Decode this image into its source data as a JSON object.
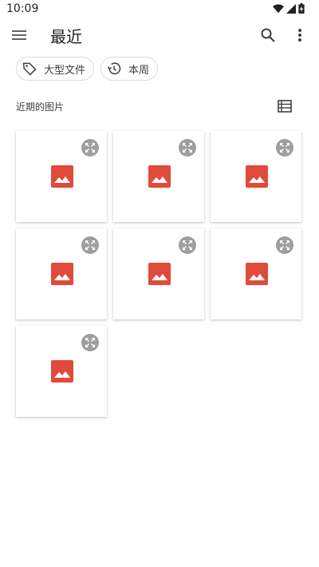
{
  "status_bar": {
    "time": "10:09"
  },
  "app_bar": {
    "title": "最近"
  },
  "chips": [
    {
      "label": "大型文件",
      "icon": "label-icon"
    },
    {
      "label": "本周",
      "icon": "history-icon"
    }
  ],
  "section": {
    "title": "近期的图片"
  },
  "colors": {
    "image_icon": "#e04a3b",
    "expand_icon": "#9e9e9e",
    "text": "#202124"
  },
  "images": [
    {
      "icon": "image-icon"
    },
    {
      "icon": "image-icon"
    },
    {
      "icon": "image-icon"
    },
    {
      "icon": "image-icon"
    },
    {
      "icon": "image-icon"
    },
    {
      "icon": "image-icon"
    },
    {
      "icon": "image-icon"
    }
  ]
}
